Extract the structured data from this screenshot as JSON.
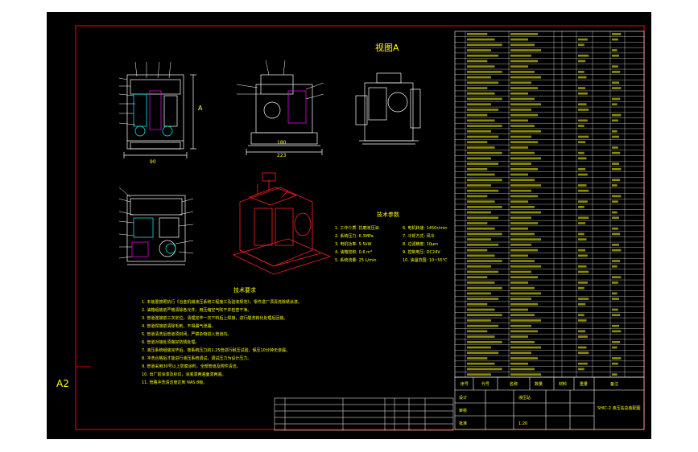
{
  "drawing": {
    "view_label": "视图A",
    "sheet_size": "A2",
    "tech_params_title": "技术参数",
    "tech_requirements_title": "技术要求",
    "dims": {
      "front_height": "A",
      "front_width": "90",
      "side_width_upper": "180",
      "side_width_lower": "223"
    },
    "tech_params": [
      "1. 工作介质: 抗磨液压油",
      "2. 系统压力: 6.3MPa",
      "3. 电机功率: 5.5kW",
      "4. 油箱容积: 0.6 m³",
      "5. 系统流量: 25 L/min"
    ],
    "tech_params_right": [
      "6. 电机转速: 1450r/min",
      "7. 冷却方式: 风冷",
      "8. 过滤精度: 10μm",
      "9. 控制电压: DC24V",
      "10. 油温范围: 10~55℃"
    ],
    "tech_requirements": [
      "1. 本装置按照执行《冶金机械液压系统工程施工及验收规范》，零件进厂须清洗除锈涂漆。",
      "2. 油箱组装前严格清除各元件，用压缩空气吹干并检查干净。",
      "3. 管道连接前三次定位，清理完毕一次下料后上焊接，进行酸洗钝化处理后回装。",
      "4. 管道焊接前清除毛刺、不得漏气泄漏。",
      "5. 管道清洗后管道须封闭，严禁杂物进入管道内。",
      "6. 管道对接处须做好防锈处理。",
      "7. 液压系统组装完毕后，按系统压力的1.25倍进行耐压试验，保压10分钟无渗漏。",
      "8. 冲洗合格后才能进行液压系统调试，调试压力为设计压力。",
      "9. 管道采用30号以上防腐涂料，全部管道及附件清洁。",
      "10. 出厂前涂漆及标识，涂底漆两遍面漆两遍。",
      "11. 管路冲洗清洁度达到 NAS 8级。"
    ],
    "title_block": {
      "company": "液压站",
      "drawing_no": "SHIC-2 液压站总装配图",
      "scale": "1:20",
      "designer": "设计",
      "checker": "审核",
      "approver": "批准",
      "material": "材料",
      "weight": "重量",
      "quantity": "数量",
      "remark": "备注",
      "seq_label": "序号",
      "code_label": "代号",
      "name_label": "名称"
    }
  },
  "colors": {
    "background": "#000000",
    "border": "#ff0000",
    "lines": "#ffffff",
    "text": "#ffff00",
    "accent": "#00ffff",
    "magenta": "#ff00ff",
    "iso_red": "#ff2020"
  }
}
